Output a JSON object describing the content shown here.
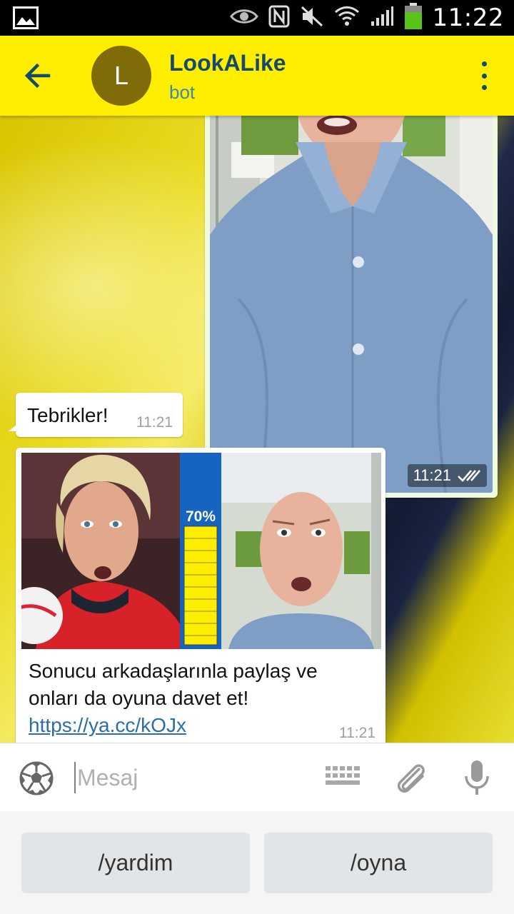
{
  "status_bar": {
    "time": "11:22",
    "icons": [
      "gallery-icon",
      "eye-icon",
      "nfc-icon",
      "mute-icon",
      "wifi-icon",
      "signal-icon",
      "battery-icon"
    ]
  },
  "header": {
    "avatar_letter": "L",
    "title": "LookALike",
    "subtitle": "bot",
    "accent": "#ffee00",
    "avatar_color": "#7f6c08"
  },
  "messages": [
    {
      "type": "photo",
      "direction": "outgoing",
      "time": "11:21",
      "status": "read"
    },
    {
      "type": "text",
      "direction": "incoming",
      "text": "Tebrikler!",
      "time": "11:21"
    },
    {
      "type": "photo_caption",
      "direction": "incoming",
      "match_percent": "70%",
      "match_level": 0.7,
      "caption": "Sonucu arkadaşlarınla paylaş ve onları da oyuna davet et! ",
      "link": "https://ya.cc/kOJx",
      "time": "11:21"
    }
  ],
  "input": {
    "placeholder": "Mesaj",
    "value": ""
  },
  "keyboard": {
    "buttons": [
      "/yardim",
      "/oyna"
    ]
  }
}
